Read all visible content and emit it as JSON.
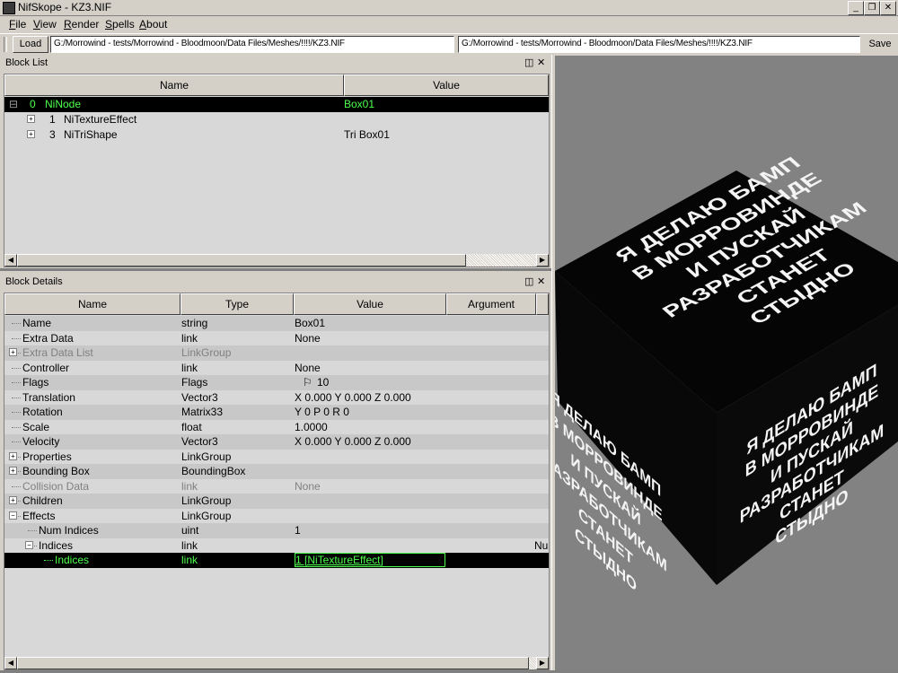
{
  "window": {
    "title": "NifSkope - KZ3.NIF"
  },
  "menu": [
    "File",
    "View",
    "Render",
    "Spells",
    "About"
  ],
  "toolbar": {
    "load_label": "Load",
    "load_path": "G:/Morrowind - tests/Morrowind - Bloodmoon/Data Files/Meshes/!!!!/KZ3.NIF",
    "save_path": "G:/Morrowind - tests/Morrowind - Bloodmoon/Data Files/Meshes/!!!!/KZ3.NIF",
    "save_label": "Save"
  },
  "block_list": {
    "title": "Block List",
    "columns": [
      "Name",
      "Value"
    ],
    "rows": [
      {
        "index": "0",
        "name": "NiNode",
        "value": "Box01",
        "selected": true
      },
      {
        "index": "1",
        "name": "NiTextureEffect",
        "value": ""
      },
      {
        "index": "3",
        "name": "NiTriShape",
        "value": "Tri Box01"
      }
    ]
  },
  "block_details": {
    "title": "Block Details",
    "columns": [
      "Name",
      "Type",
      "Value",
      "Argument"
    ],
    "rows": [
      {
        "name": "Name",
        "type": "string",
        "value": "Box01",
        "argument": ""
      },
      {
        "name": "Extra Data",
        "type": "link",
        "value": "None",
        "argument": ""
      },
      {
        "name": "Extra Data List",
        "type": "LinkGroup",
        "value": "",
        "argument": "",
        "muted": true,
        "expandable": true
      },
      {
        "name": "Controller",
        "type": "link",
        "value": "None",
        "argument": ""
      },
      {
        "name": "Flags",
        "type": "Flags",
        "value": "10",
        "argument": "",
        "flag_icon": true
      },
      {
        "name": "Translation",
        "type": "Vector3",
        "value": "X 0.000 Y 0.000 Z 0.000",
        "argument": ""
      },
      {
        "name": "Rotation",
        "type": "Matrix33",
        "value": "Y 0 P 0 R 0",
        "argument": ""
      },
      {
        "name": "Scale",
        "type": "float",
        "value": "1.0000",
        "argument": ""
      },
      {
        "name": "Velocity",
        "type": "Vector3",
        "value": "X 0.000 Y 0.000 Z 0.000",
        "argument": ""
      },
      {
        "name": "Properties",
        "type": "LinkGroup",
        "value": "",
        "argument": "",
        "expandable": true
      },
      {
        "name": "Bounding Box",
        "type": "BoundingBox",
        "value": "",
        "argument": "",
        "expandable": true
      },
      {
        "name": "Collision Data",
        "type": "link",
        "value": "None",
        "argument": "",
        "muted": true
      },
      {
        "name": "Children",
        "type": "LinkGroup",
        "value": "",
        "argument": "",
        "expandable": true
      },
      {
        "name": "Effects",
        "type": "LinkGroup",
        "value": "",
        "argument": "",
        "expanded": true
      },
      {
        "name": "Num Indices",
        "type": "uint",
        "value": "1",
        "argument": ""
      },
      {
        "name": "Indices",
        "type": "link",
        "value": "",
        "argument": "Nu",
        "expanded": true
      },
      {
        "name": "Indices",
        "type": "link",
        "value": "1 [NiTextureEffect]",
        "argument": "",
        "selected": true
      }
    ]
  },
  "viewport": {
    "cube_text_top": [
      "Я ДЕЛАЮ БАМП",
      "В МОРРОВИНДЕ",
      "И ПУСКАЙ",
      "РАЗРАБОТЧИКАМ",
      "СТАНЕТ",
      "СТЫДНО"
    ],
    "cube_text_front": [
      "Я ДЕЛАЮ БАМП",
      "В МОРРОВИНДЕ",
      "И ПУСКАЙ",
      "РАЗРАБОТЧИКАМ",
      "СТАНЕТ",
      "СТЫДНО"
    ],
    "cube_text_side": [
      "Я ДЕЛАЮ БАМП",
      "В МОРРОВИНДЕ",
      "И ПУСКАЙ",
      "РАЗРАБОТЧИКАМ",
      "СТАНЕТ",
      "СТЫДНО"
    ]
  },
  "colors": {
    "selection_bg": "#000000",
    "selection_fg": "#4cff4c",
    "chrome": "#d4d0c8",
    "viewport_bg": "#828282"
  }
}
